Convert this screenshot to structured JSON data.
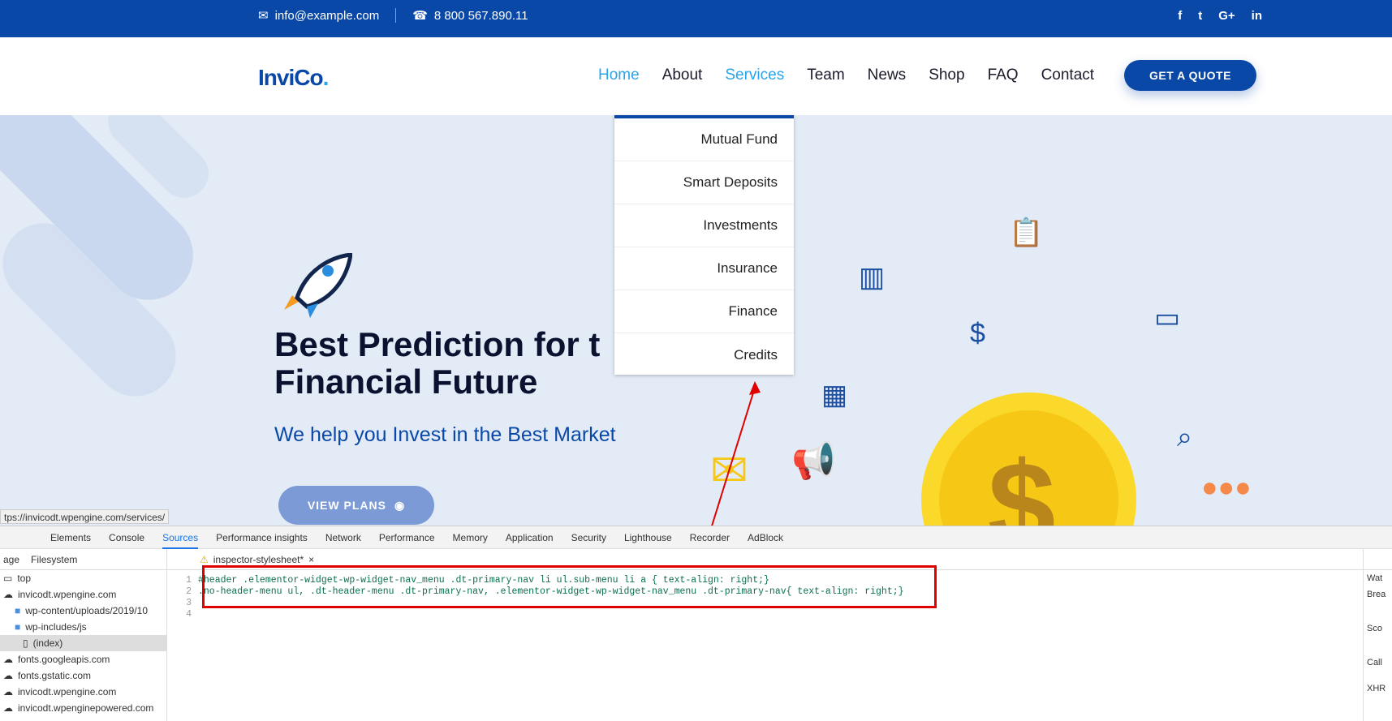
{
  "topbar": {
    "email": "info@example.com",
    "phone": "8 800 567.890.11",
    "social": [
      "f",
      "t",
      "G+",
      "in"
    ]
  },
  "header": {
    "logo_main": "InviCo",
    "logo_dot": ".",
    "nav": [
      "Home",
      "About",
      "Services",
      "Team",
      "News",
      "Shop",
      "FAQ",
      "Contact"
    ],
    "active_nav": "Home",
    "quote_label": "GET A QUOTE"
  },
  "hero": {
    "title": "Best Prediction for t Financial Future",
    "subtitle": "We help you Invest in the Best Market",
    "plans_label": "VIEW PLANS"
  },
  "dropdown": {
    "items": [
      "Mutual Fund",
      "Smart Deposits",
      "Investments",
      "Insurance",
      "Finance",
      "Credits"
    ]
  },
  "status_url": "tps://invicodt.wpengine.com/services/",
  "devtools": {
    "tabs": [
      "Elements",
      "Console",
      "Sources",
      "Performance insights",
      "Network",
      "Performance",
      "Memory",
      "Application",
      "Security",
      "Lighthouse",
      "Recorder",
      "AdBlock"
    ],
    "selected_tab": "Sources",
    "left_tabs": [
      "age",
      "Filesystem"
    ],
    "tree": [
      "top",
      "invicodt.wpengine.com",
      "wp-content/uploads/2019/10",
      "wp-includes/js",
      "(index)",
      "fonts.googleapis.com",
      "fonts.gstatic.com",
      "invicodt.wpengine.com",
      "invicodt.wpenginepowered.com"
    ],
    "editor_tab": "inspector-stylesheet*",
    "code": [
      {
        "n": "1",
        "text": "#header .elementor-widget-wp-widget-nav_menu .dt-primary-nav li ul.sub-menu li a {  text-align: right;}"
      },
      {
        "n": "2",
        "text": ".no-header-menu ul, .dt-header-menu .dt-primary-nav, .elementor-widget-wp-widget-nav_menu .dt-primary-nav{  text-align: right;}"
      },
      {
        "n": "3",
        "text": ""
      },
      {
        "n": "4",
        "text": ""
      }
    ],
    "right_labels": [
      "Wat",
      "Brea",
      "Sco",
      "Call",
      "XHR"
    ]
  }
}
